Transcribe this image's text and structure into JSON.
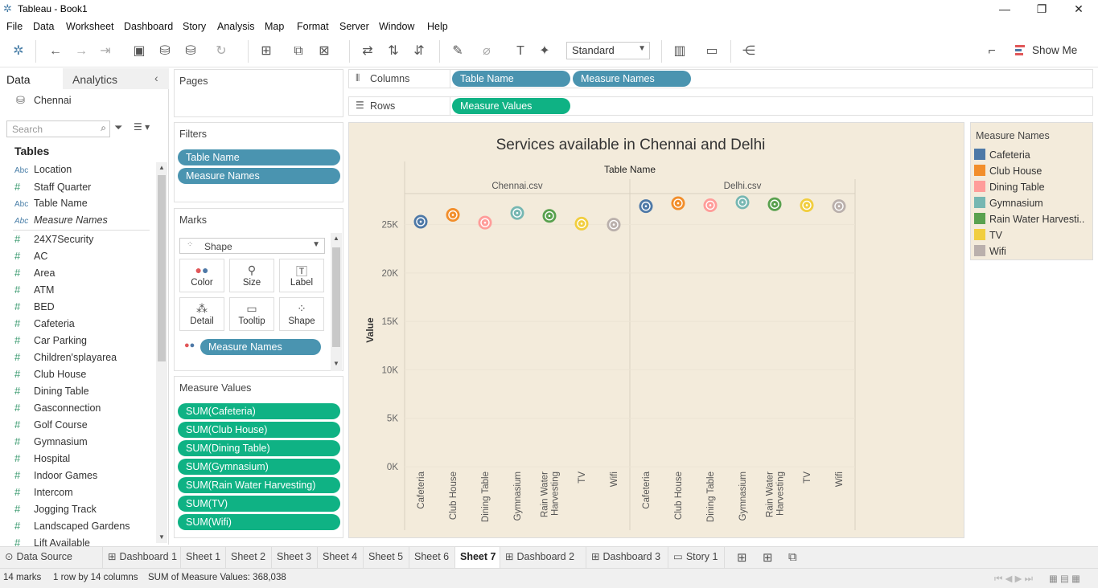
{
  "window": {
    "title": "Tableau - Book1",
    "minimize_icon": "—",
    "restore_icon": "❐",
    "close_icon": "✕"
  },
  "menu": [
    "File",
    "Data",
    "Worksheet",
    "Dashboard",
    "Story",
    "Analysis",
    "Map",
    "Format",
    "Server",
    "Window",
    "Help"
  ],
  "toolbar": {
    "fit_value": "Standard",
    "show_me_label": "Show Me"
  },
  "data_pane": {
    "tab_data": "Data",
    "tab_analytics": "Analytics",
    "datasource": "Chennai",
    "search_placeholder": "Search",
    "tables_heading": "Tables",
    "dimensions": [
      {
        "type": "Abc",
        "name": "Location"
      },
      {
        "type": "#",
        "name": "Staff Quarter"
      },
      {
        "type": "Abc",
        "name": "Table Name"
      },
      {
        "type": "Abc",
        "name": "Measure Names"
      }
    ],
    "measures": [
      "24X7Security",
      "AC",
      "Area",
      "ATM",
      "BED",
      "Cafeteria",
      "Car Parking",
      "Children'splayarea",
      "Club House",
      "Dining Table",
      "Gasconnection",
      "Golf Course",
      "Gymnasium",
      "Hospital",
      "Indoor Games",
      "Intercom",
      "Jogging Track",
      "Landscaped Gardens",
      "Lift Available"
    ]
  },
  "shelves": {
    "pages": "Pages",
    "filters": "Filters",
    "filter_pills": [
      "Table Name",
      "Measure Names"
    ],
    "marks": "Marks",
    "mark_type": "Shape",
    "mark_buttons": [
      "Color",
      "Size",
      "Label",
      "Detail",
      "Tooltip",
      "Shape"
    ],
    "mark_pill": "Measure Names",
    "measure_values": "Measure Values",
    "measure_pills": [
      "SUM(Cafeteria)",
      "SUM(Club House)",
      "SUM(Dining Table)",
      "SUM(Gymnasium)",
      "SUM(Rain Water Harvesting)",
      "SUM(TV)",
      "SUM(Wifi)"
    ],
    "columns_label": "Columns",
    "rows_label": "Rows",
    "columns_pills": [
      "Table Name",
      "Measure Names"
    ],
    "rows_pills": [
      "Measure Values"
    ]
  },
  "chart_data": {
    "type": "scatter",
    "title": "Services available in Chennai and Delhi",
    "column_header": "Table Name",
    "panes": [
      "Chennai.csv",
      "Delhi.csv"
    ],
    "categories": [
      "Cafeteria",
      "Club House",
      "Dining Table",
      "Gymnasium",
      "Rain Water Harvesting",
      "TV",
      "Wifi"
    ],
    "category_labels": [
      [
        "Cafeteria"
      ],
      [
        "Club House"
      ],
      [
        "Dining Table"
      ],
      [
        "Gymnasium"
      ],
      [
        "Rain Water",
        "Harvesting"
      ],
      [
        "TV"
      ],
      [
        "Wifi"
      ]
    ],
    "ylabel": "Value",
    "ylim": [
      0,
      28200
    ],
    "yticks": [
      {
        "v": 0,
        "label": "0K"
      },
      {
        "v": 5000,
        "label": "5K"
      },
      {
        "v": 10000,
        "label": "10K"
      },
      {
        "v": 15000,
        "label": "15K"
      },
      {
        "v": 20000,
        "label": "20K"
      },
      {
        "v": 25000,
        "label": "25K"
      }
    ],
    "series": [
      {
        "name": "Chennai.csv",
        "values": [
          25300,
          26000,
          25200,
          26200,
          25900,
          25100,
          25000
        ]
      },
      {
        "name": "Delhi.csv",
        "values": [
          26900,
          27200,
          27000,
          27300,
          27100,
          27000,
          26900
        ]
      }
    ],
    "colors": [
      "#4e79a7",
      "#f28e2b",
      "#ff9d9a",
      "#76b7b2",
      "#59a14f",
      "#f1ce3f",
      "#bab0ac"
    ],
    "grid": true,
    "legend": {
      "title": "Measure Names",
      "position": "right",
      "items": [
        "Cafeteria",
        "Club House",
        "Dining Table",
        "Gymnasium",
        "Rain Water Harvesti..",
        "TV",
        "Wifi"
      ]
    }
  },
  "sheet_tabs": [
    {
      "label": "Data Source",
      "icon": "⊙"
    },
    {
      "label": "Dashboard 1",
      "icon": "⊞"
    },
    {
      "label": "Sheet 1",
      "icon": ""
    },
    {
      "label": "Sheet 2",
      "icon": ""
    },
    {
      "label": "Sheet 3",
      "icon": ""
    },
    {
      "label": "Sheet 4",
      "icon": ""
    },
    {
      "label": "Sheet 5",
      "icon": ""
    },
    {
      "label": "Sheet 6",
      "icon": ""
    },
    {
      "label": "Sheet 7",
      "icon": "",
      "active": true
    },
    {
      "label": "Dashboard 2",
      "icon": "⊞"
    },
    {
      "label": "Dashboard 3",
      "icon": "⊞"
    },
    {
      "label": "Story 1",
      "icon": "▭"
    }
  ],
  "status": {
    "marks": "14 marks",
    "layout": "1 row by 14 columns",
    "sum": "SUM of Measure Values: 368,038"
  }
}
